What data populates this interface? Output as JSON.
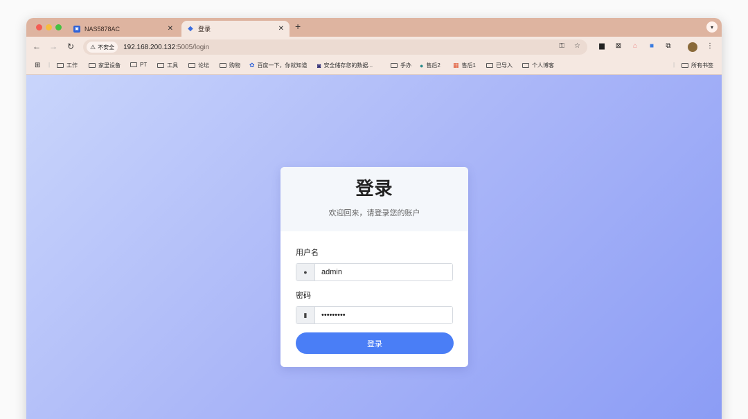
{
  "tabs": [
    {
      "title": "NAS5878AC",
      "icon": "nas-icon"
    },
    {
      "title": "登录",
      "icon": "app-icon"
    }
  ],
  "toolbar": {
    "security_label": "不安全",
    "url_host": "192.168.200.132",
    "url_rest": ":5005/login"
  },
  "bookmarks": {
    "items": [
      {
        "label": "工作"
      },
      {
        "label": "家里设备"
      },
      {
        "label": "PT"
      },
      {
        "label": "工具"
      },
      {
        "label": "论坛"
      },
      {
        "label": "购物"
      },
      {
        "label": "百度一下，你就知道"
      },
      {
        "label": "安全储存您的数据..."
      },
      {
        "label": "手办"
      },
      {
        "label": "售后2"
      },
      {
        "label": "售后1"
      },
      {
        "label": "已导入"
      },
      {
        "label": "个人博客"
      }
    ],
    "all_bookmarks": "所有书签"
  },
  "login": {
    "title": "登录",
    "subtitle": "欢迎回来，请登录您的账户",
    "username_label": "用户名",
    "username_value": "admin",
    "password_label": "密码",
    "password_value": "•••••••••",
    "submit_label": "登录"
  },
  "colors": {
    "accent": "#4a7ef6",
    "tab_bar": "#deb4a0",
    "gradient_start": "#c9d5fb",
    "gradient_end": "#8b9cf5"
  }
}
